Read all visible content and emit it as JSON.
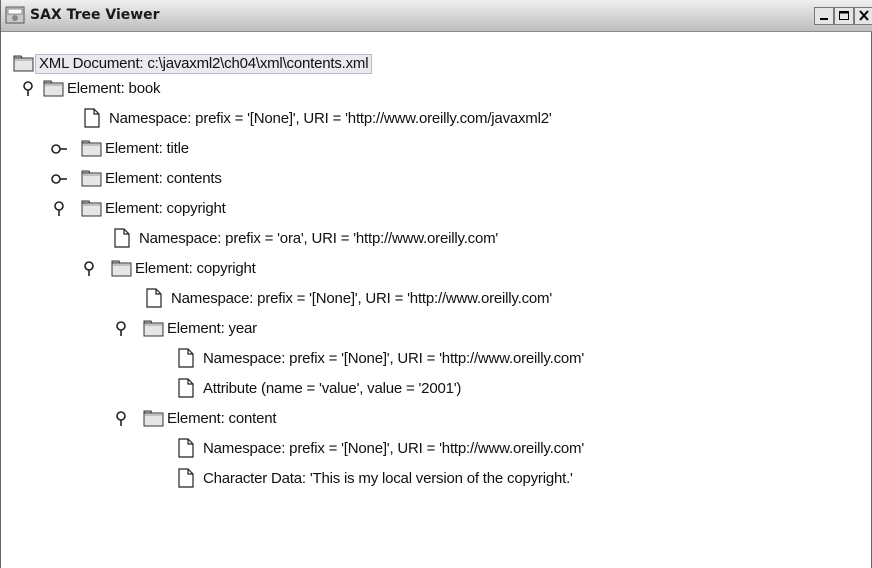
{
  "window": {
    "title": "SAX Tree Viewer"
  },
  "tree": {
    "root": "XML Document: c:\\javaxml2\\ch04\\xml\\contents.xml",
    "nodes": [
      "Element: book",
      "Namespace: prefix = '[None]', URI = 'http://www.oreilly.com/javaxml2'",
      "Element: title",
      "Element: contents",
      "Element: copyright",
      "Namespace: prefix = 'ora', URI = 'http://www.oreilly.com'",
      "Element: copyright",
      "Namespace: prefix = '[None]', URI = 'http://www.oreilly.com'",
      "Element: year",
      "Namespace: prefix = '[None]', URI = 'http://www.oreilly.com'",
      "Attribute (name = 'value', value = '2001')",
      "Element: content",
      "Namespace: prefix = '[None]', URI = 'http://www.oreilly.com'",
      "Character Data: 'This is my local version of the copyright.'"
    ],
    "node_states": [
      "expanded",
      "leaf",
      "collapsed",
      "collapsed",
      "expanded",
      "leaf",
      "expanded",
      "leaf",
      "expanded",
      "leaf",
      "leaf",
      "expanded",
      "leaf",
      "leaf"
    ]
  },
  "colors": {
    "titlebar": "#d2d2d2",
    "folder": "#c8c8c8",
    "selection": "#e9e9ee"
  }
}
